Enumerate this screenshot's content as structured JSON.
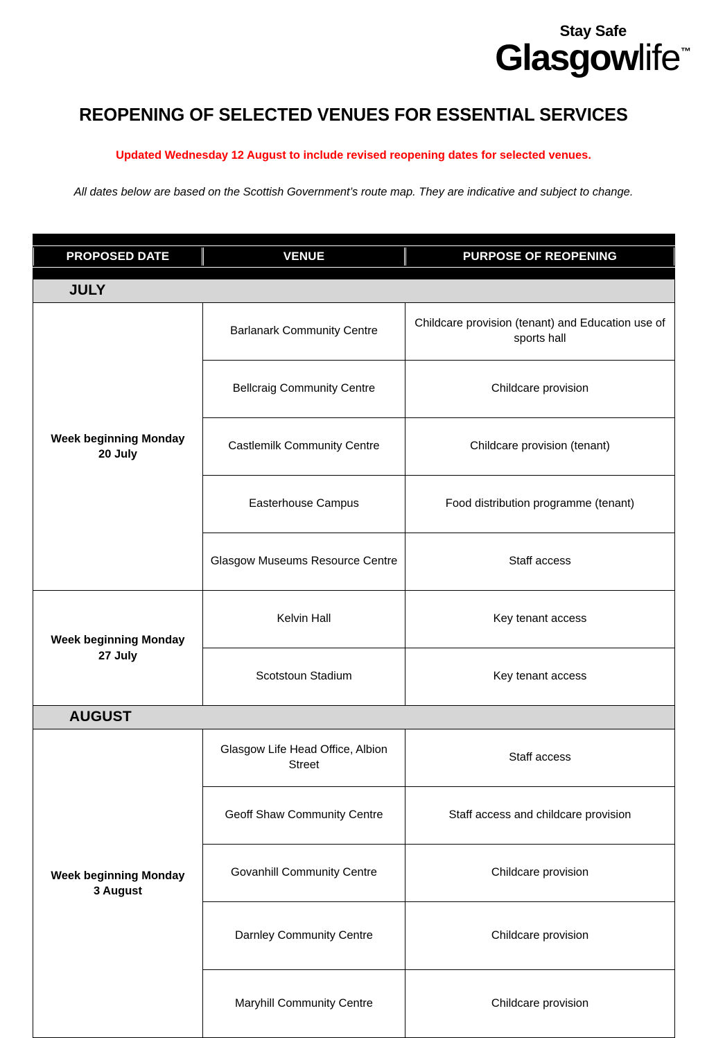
{
  "logo": {
    "tagline": "Stay Safe",
    "brand_bold": "Glasgow",
    "brand_light": "life",
    "trademark": "™"
  },
  "document": {
    "title": "REOPENING OF SELECTED VENUES FOR ESSENTIAL SERVICES",
    "update_note": "Updated Wednesday 12 August to include revised reopening dates for selected venues.",
    "disclaimer": "All dates below are based on the Scottish Government’s route map. They are indicative and subject to change.",
    "update_note_color": "#FF0000"
  },
  "table": {
    "headers": {
      "date": "PROPOSED DATE",
      "venue": "VENUE",
      "purpose": "PURPOSE OF REOPENING"
    },
    "header_bg": "#000000",
    "header_fg": "#FFFFFF",
    "month_band_bg": "#D6D6D6",
    "months": [
      {
        "name": "JULY",
        "groups": [
          {
            "date": "Week beginning Monday\n20 July",
            "date_line1": "Week beginning Monday",
            "date_line2": "20 July",
            "rows": [
              {
                "venue": "Barlanark Community Centre",
                "purpose": "Childcare provision (tenant) and Education use of sports hall"
              },
              {
                "venue": "Bellcraig Community Centre",
                "purpose": "Childcare provision"
              },
              {
                "venue": "Castlemilk Community Centre",
                "purpose": "Childcare provision (tenant)"
              },
              {
                "venue": "Easterhouse Campus",
                "purpose": "Food distribution programme (tenant)"
              },
              {
                "venue": "Glasgow Museums Resource Centre",
                "purpose": "Staff access"
              }
            ]
          },
          {
            "date_line1": "Week beginning Monday",
            "date_line2": "27 July",
            "rows": [
              {
                "venue": "Kelvin Hall",
                "purpose": "Key tenant access"
              },
              {
                "venue": "Scotstoun Stadium",
                "purpose": "Key tenant access"
              }
            ]
          }
        ]
      },
      {
        "name": "AUGUST",
        "groups": [
          {
            "date_line1": "Week beginning Monday",
            "date_line2": "3 August",
            "rows": [
              {
                "venue": "Glasgow Life Head Office, Albion Street",
                "purpose": "Staff access"
              },
              {
                "venue": "Geoff Shaw Community Centre",
                "purpose": "Staff access and childcare provision"
              },
              {
                "venue": "Govanhill Community Centre",
                "purpose": "Childcare provision"
              },
              {
                "venue": "Darnley Community Centre",
                "purpose": "Childcare provision"
              },
              {
                "venue": "Maryhill Community Centre",
                "purpose": "Childcare provision"
              }
            ]
          }
        ]
      }
    ]
  }
}
